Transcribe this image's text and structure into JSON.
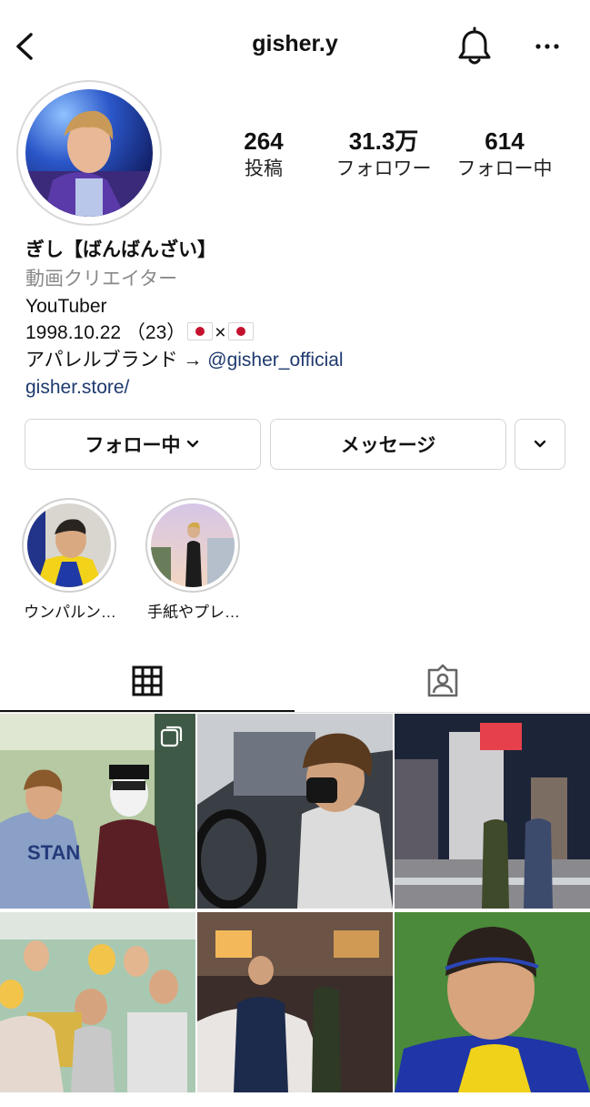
{
  "header": {
    "username": "gisher.y"
  },
  "stats": [
    {
      "value": "264",
      "label": "投稿"
    },
    {
      "value": "31.3万",
      "label": "フォロワー"
    },
    {
      "value": "614",
      "label": "フォロー中"
    }
  ],
  "bio": {
    "name": "ぎし【ばんばんざい】",
    "category": "動画クリエイター",
    "line1": "YouTuber",
    "line2_text": "1998.10.22 （23）",
    "line2_times": "×",
    "line3_text": "アパレルブランド → ",
    "line3_mention": "@gisher_official",
    "link": "gisher.store/"
  },
  "buttons": {
    "follow_label": "フォロー中",
    "message_label": "メッセージ"
  },
  "highlights": [
    {
      "label": "ウンパルン…"
    },
    {
      "label": "手紙やプレ…"
    }
  ],
  "tabs": {
    "active": "grid",
    "items": [
      "grid-icon",
      "tagged-icon"
    ]
  },
  "grid": {
    "multi_indicator_on_first": true,
    "cells": 6
  },
  "colors": {
    "link": "#1e3a6e",
    "border": "#d4d4d4",
    "secondary_text": "#8a8a8a"
  }
}
